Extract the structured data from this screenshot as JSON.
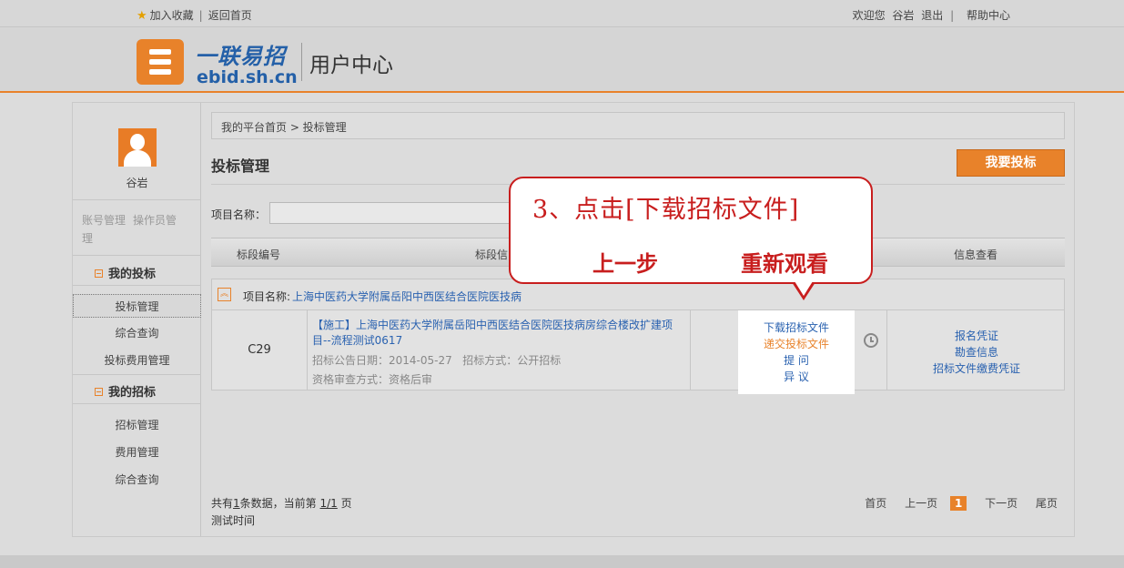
{
  "topbar": {
    "favorite": "加入收藏",
    "back_home": "返回首页",
    "welcome": "欢迎您",
    "user": "谷岩",
    "logout": "退出",
    "help": "帮助中心"
  },
  "header": {
    "logo_text": "一联易招",
    "logo_url": "ebid.sh.cn",
    "center": "用户中心"
  },
  "sidebar": {
    "user_name": "谷岩",
    "account_mgmt": "账号管理",
    "operator_mgmt": "操作员管理",
    "my_bids": {
      "title": "我的投标",
      "items": [
        "投标管理",
        "综合查询",
        "投标费用管理"
      ]
    },
    "my_tenders": {
      "title": "我的招标",
      "items": [
        "招标管理",
        "费用管理",
        "综合查询"
      ]
    }
  },
  "main": {
    "breadcrumb": "我的平台首页 > 投标管理",
    "title": "投标管理",
    "bid_button": "我要投标",
    "project_name_label": "项目名称：",
    "columns": [
      "标段编号",
      "标段信",
      "信息查看"
    ],
    "project": {
      "label": "项目名称:",
      "name": "上海中医药大学附属岳阳中西医结合医院医技病"
    },
    "row": {
      "code": "C29",
      "title": "【施工】上海中医药大学附属岳阳中西医结合医院医技病房综合楼改扩建项目--流程测试0617",
      "announce_date": "招标公告日期：2014-05-27",
      "method": "招标方式：公开招标",
      "review": "资格审查方式：资格后审",
      "ops": [
        "下载招标文件",
        "递交投标文件",
        "提 问",
        "异 议"
      ],
      "info_links": [
        "报名凭证",
        "勘查信息",
        "招标文件缴费凭证"
      ]
    },
    "pager": {
      "total_prefix": "共有",
      "total": "1",
      "total_mid": "条数据，当前第",
      "page": "1/1",
      "page_suffix": "页",
      "test_time": "测试时间",
      "first": "首页",
      "prev": "上一页",
      "current": "1",
      "next": "下一页",
      "last": "尾页"
    }
  },
  "callout": {
    "title": "3、点击[下载招标文件]",
    "prev": "上一步",
    "replay": "重新观看"
  },
  "colors": {
    "accent": "#e8822a",
    "link": "#2a62b0",
    "callout": "#c81e1e",
    "orange_link": "#e8822a"
  }
}
